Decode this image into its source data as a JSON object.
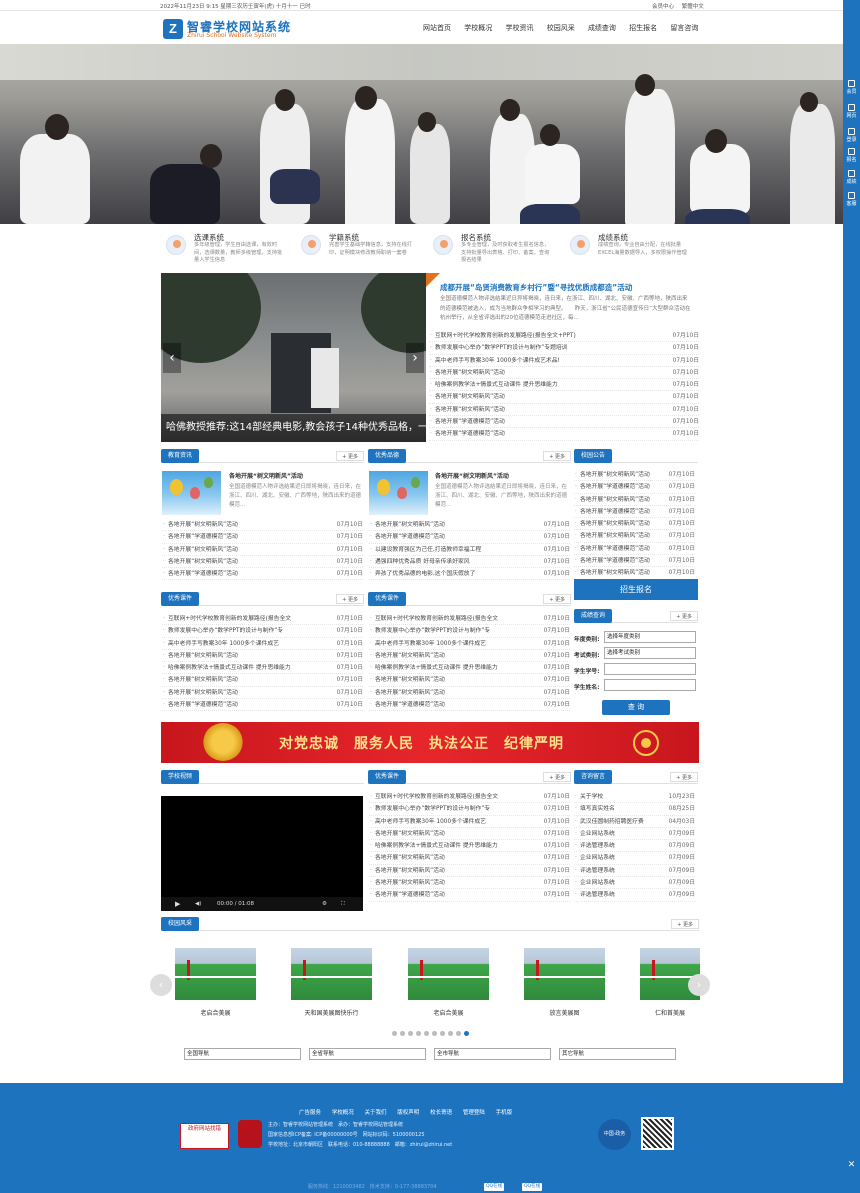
{
  "topbar": {
    "date": "2022年11月23日 9:15 星期三农历壬寅年(虎) 十月十一 巳时",
    "links": [
      "会员中心",
      "繁體中文"
    ]
  },
  "header": {
    "logo_letter": "Z",
    "logo_cn": "智睿学校网站系统",
    "logo_en": "Zhirui School Website System",
    "nav": [
      "网站首页",
      "学校概况",
      "学校资讯",
      "校园风采",
      "成绩查询",
      "招生报名",
      "留言咨询"
    ]
  },
  "rightbar": [
    "会员",
    "网页",
    "登录",
    "报名",
    "成绩",
    "客服"
  ],
  "features": [
    {
      "title": "选课系统",
      "desc": "多年级管理，学生自由选课，有效时间，选课数量，教师多级管理，支持批量入学生信息"
    },
    {
      "title": "学籍系统",
      "desc": "完善学生基础学籍信息，支持在线打印，证明模块修改教师职纳一套卷"
    },
    {
      "title": "报名系统",
      "desc": "多专业管理，及时获取考生报名信息，支持批量导出表格、打印、备案，查询报名结果"
    },
    {
      "title": "成绩系统",
      "desc": "成绩查询，专业自由分配，在线批量EXCEL海量数据导入，多权限操作管理"
    }
  ],
  "slider": {
    "caption": "哈佛教授推荐:这14部经典电影,教会孩子14种优秀品格，一生受益"
  },
  "headline": {
    "title": "成都开展“岛贤消费教育乡村行”暨“寻找优质成都造”活动",
    "desc": "全国道德模范人物评选结果近日异将揭晓，连日来，在浙江、四川、湖北、安徽、广西等地，陕西出来的道德模范被选入，成为当地群众争相学习的典型。　　昨天，浙江省“公民道德宣传日”大型群众活动在杭州举行，从全省评选出的20位道德模范走进社区，每..."
  },
  "headline_list": [
    {
      "t": "互联网+时代学校教育创新的发展路径(报告全文+PPT)",
      "d": "07月10日"
    },
    {
      "t": "教师发展中心举办“数学PPT的设计与制作”专题培训",
      "d": "07月10日"
    },
    {
      "t": "高中老师手写教案30年 1000多个课件成艺术品!",
      "d": "07月10日"
    },
    {
      "t": "各地开展“树文明新风”活动",
      "d": "07月10日"
    },
    {
      "t": "哈佛案例教学法+情景式互动课件 提升思维能力",
      "d": "07月10日"
    },
    {
      "t": "各地开展“树文明新风”活动",
      "d": "07月10日"
    },
    {
      "t": "各地开展“树文明新风”活动",
      "d": "07月10日"
    },
    {
      "t": "各地开展“学道德模范”活动",
      "d": "07月10日"
    },
    {
      "t": "各地开展“学道德模范”活动",
      "d": "07月10日"
    }
  ],
  "more_label": "+ 更多",
  "news1": {
    "tab": "教育资讯",
    "title": "各地开展“树文明新风”活动",
    "desc": "全国道德模范人物评选结果近日即将揭晓，连日来，在浙江、四川、湖北、安徽、广西等地，陕西出来的道德模范...",
    "list": [
      {
        "t": "各地开展“树文明新风”活动",
        "d": "07月10日"
      },
      {
        "t": "各地开展“学道德模范”活动",
        "d": "07月10日"
      },
      {
        "t": "各地开展“树文明新风”活动",
        "d": "07月10日"
      },
      {
        "t": "各地开展“树文明新风”活动",
        "d": "07月10日"
      },
      {
        "t": "各地开展“学道德模范”活动",
        "d": "07月10日"
      }
    ]
  },
  "news2": {
    "tab": "优秀品德",
    "title": "各地开展“树文明新风”活动",
    "desc": "全国道德模范人物评选结果近日即将揭晓，连日来，在浙江、四川、湖北、安徽、广西等地，陕西出来的道德模范...",
    "list": [
      {
        "t": "各地开展“树文明新风”活动",
        "d": "07月10日"
      },
      {
        "t": "各地开展“学道德模范”活动",
        "d": "07月10日"
      },
      {
        "t": "以建设教育强区为己任,打造教师幸福工程",
        "d": "07月10日"
      },
      {
        "t": "遇强四种优秀品质 好母亲传承好家风",
        "d": "07月10日"
      },
      {
        "t": "弄孩了优秀品德的电影,这个国庆假放了",
        "d": "07月10日"
      }
    ]
  },
  "notice": {
    "tab": "校园公告",
    "list": [
      {
        "t": "各地开展“树文明新风”活动",
        "d": "07月10日"
      },
      {
        "t": "各地开展“学道德模范”活动",
        "d": "07月10日"
      },
      {
        "t": "各地开展“树文明新风”活动",
        "d": "07月10日"
      },
      {
        "t": "各地开展“学道德模范”活动",
        "d": "07月10日"
      },
      {
        "t": "各地开展“树文明新风”活动",
        "d": "07月10日"
      },
      {
        "t": "各地开展“树文明新风”活动",
        "d": "07月10日"
      },
      {
        "t": "各地开展“学道德模范”活动",
        "d": "07月10日"
      },
      {
        "t": "各地开展“学道德模范”活动",
        "d": "07月10日"
      },
      {
        "t": "各地开展“树文明新风”活动",
        "d": "07月10日"
      }
    ]
  },
  "signup_label": "招生报名",
  "courses1": {
    "tab": "优秀课件",
    "list": [
      {
        "t": "互联网+时代学校教育创新的发展路径(报告全文",
        "d": "07月10日"
      },
      {
        "t": "教师发展中心举办“数学PPT的设计与制作”专",
        "d": "07月10日"
      },
      {
        "t": "高中老师手写教案30年 1000多个课件成艺",
        "d": "07月10日"
      },
      {
        "t": "各地开展“树文明新风”活动",
        "d": "07月10日"
      },
      {
        "t": "哈佛案例教学法+情景式互动课件 提升思维能力",
        "d": "07月10日"
      },
      {
        "t": "各地开展“树文明新风”活动",
        "d": "07月10日"
      },
      {
        "t": "各地开展“树文明新风”活动",
        "d": "07月10日"
      },
      {
        "t": "各地开展“学道德模范”活动",
        "d": "07月10日"
      }
    ]
  },
  "courses2": {
    "tab": "优秀课件",
    "list": [
      {
        "t": "互联网+时代学校教育创新的发展路径(报告全文",
        "d": "07月10日"
      },
      {
        "t": "教师发展中心举办“数学PPT的设计与制作”专",
        "d": "07月10日"
      },
      {
        "t": "高中老师手写教案30年 1000多个课件成艺",
        "d": "07月10日"
      },
      {
        "t": "各地开展“树文明新风”活动",
        "d": "07月10日"
      },
      {
        "t": "哈佛案例教学法+情景式互动课件 提升思维能力",
        "d": "07月10日"
      },
      {
        "t": "各地开展“树文明新风”活动",
        "d": "07月10日"
      },
      {
        "t": "各地开展“树文明新风”活动",
        "d": "07月10日"
      },
      {
        "t": "各地开展“学道德模范”活动",
        "d": "07月10日"
      }
    ]
  },
  "score": {
    "tab": "成绩查询",
    "year_label": "年度类别:",
    "year_value": "选择年度类别",
    "exam_label": "考试类别:",
    "exam_value": "选择考试类别",
    "id_label": "学生学号:",
    "name_label": "学生姓名:",
    "button": "查 询"
  },
  "party": {
    "slogan": "对党忠诚　服务人民　执法公正　纪律严明"
  },
  "video": {
    "tab": "学校视频",
    "time": "00:00 / 01:08"
  },
  "courses3": {
    "tab": "优秀课件",
    "list": [
      {
        "t": "互联网+时代学校教育创新的发展路径(报告全文",
        "d": "07月10日"
      },
      {
        "t": "教师发展中心举办“数学PPT的设计与制作”专",
        "d": "07月10日"
      },
      {
        "t": "高中老师手写教案30年 1000多个课件成艺",
        "d": "07月10日"
      },
      {
        "t": "各地开展“树文明新风”活动",
        "d": "07月10日"
      },
      {
        "t": "哈佛案例教学法+情景式互动课件 提升思维能力",
        "d": "07月10日"
      },
      {
        "t": "各地开展“树文明新风”活动",
        "d": "07月10日"
      },
      {
        "t": "各地开展“树文明新风”活动",
        "d": "07月10日"
      },
      {
        "t": "各地开展“树文明新风”活动",
        "d": "07月10日"
      },
      {
        "t": "各地开展“学道德模范”活动",
        "d": "07月10日"
      }
    ]
  },
  "message": {
    "tab": "咨询留言",
    "list": [
      {
        "t": "关于学校",
        "d": "10月23日"
      },
      {
        "t": "填写真实姓名",
        "d": "08月25日"
      },
      {
        "t": "武汉佳圆制药招聘医疗费",
        "d": "04月03日"
      },
      {
        "t": "企业网站系统",
        "d": "07月09日"
      },
      {
        "t": "评选管理系统",
        "d": "07月09日"
      },
      {
        "t": "企业网站系统",
        "d": "07月09日"
      },
      {
        "t": "评选管理系统",
        "d": "07月09日"
      },
      {
        "t": "企业网站系统",
        "d": "07月09日"
      },
      {
        "t": "评选管理系统",
        "d": "07月09日"
      }
    ]
  },
  "gallery": {
    "tab": "校园风采",
    "items": [
      "老启合美展",
      "天和国美展图快乐行",
      "老启合美展",
      "放言美展图",
      "仁和首美展"
    ]
  },
  "selects": [
    "全国导航",
    "全省导航",
    "全市导航",
    "其它导航"
  ],
  "footer": {
    "links": [
      "广告服务",
      "学校概况",
      "关于我们",
      "版权声明",
      "校长寄语",
      "管理登陆",
      "手机版"
    ],
    "info": [
      "主办：智睿学校网站管理系统　承办：智睿学校网站管理系统",
      "国家信息部ICP备案: ICP备00000000号　网站标识码：5100000125",
      "学校地址：北京市朝阳区　联系电话：010-88888888　邮箱：zhirui@zhirui.net"
    ],
    "gov_label": "政府网站找错",
    "badge_label": "中国·政务"
  },
  "bottombar": {
    "phone": "服务热线：1210003482　技术支持：0-177-38883704",
    "qq1": "QQ在线",
    "qq2": "QQ在线"
  }
}
